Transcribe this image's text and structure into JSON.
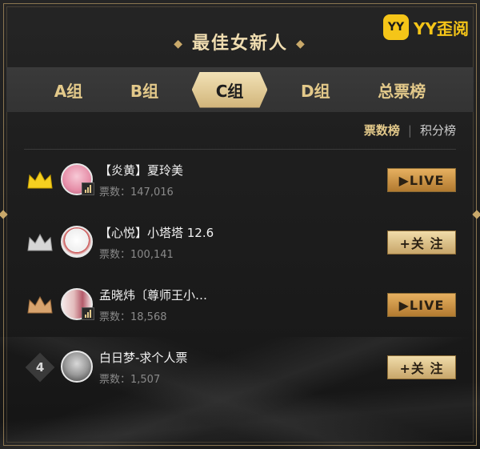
{
  "title": "最佳女新人",
  "brand": {
    "logo_text": "YY",
    "name": "YY歪阅"
  },
  "tabs": [
    {
      "label": "A组",
      "active": false
    },
    {
      "label": "B组",
      "active": false
    },
    {
      "label": "C组",
      "active": true
    },
    {
      "label": "D组",
      "active": false
    },
    {
      "label": "总票榜",
      "active": false
    }
  ],
  "sort": {
    "active": "票数榜",
    "other": "积分榜"
  },
  "entries": [
    {
      "rank": 1,
      "rank_icon": "gold-crown-icon",
      "name": "【炎黄】夏玲美",
      "votes_label": "票数：147,016",
      "action": "▶LIVE",
      "live": true
    },
    {
      "rank": 2,
      "rank_icon": "silver-crown-icon",
      "name": "【心悦】小塔塔 12.6",
      "votes_label": "票数：100,141",
      "action": "+关 注",
      "live": false
    },
    {
      "rank": 3,
      "rank_icon": "bronze-crown-icon",
      "name": "孟晓炜〔尊师王小…",
      "votes_label": "票数：18,568",
      "action": "▶LIVE",
      "live": true
    },
    {
      "rank": 4,
      "rank_icon": "rank-number-badge",
      "name": "白日梦-求个人票",
      "votes_label": "票数：1,507",
      "action": "+关 注",
      "live": false
    }
  ],
  "colors": {
    "gold": "#e3c98a",
    "crown_gold": "#f5d020",
    "crown_silver": "#d6d6d6",
    "crown_bronze": "#d8a46e"
  }
}
